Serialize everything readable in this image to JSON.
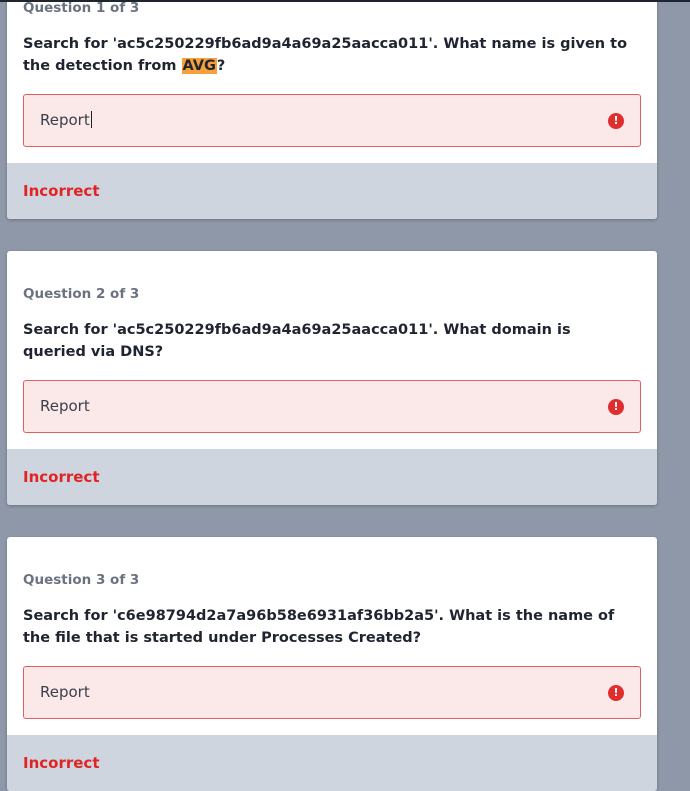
{
  "questions": [
    {
      "header": "Question 1 of 3",
      "text_before": "Search for 'ac5c250229fb6ad9a4a69a25aacca011'. What name is given to the detection from ",
      "text_highlight": "AVG",
      "text_after": "?",
      "answer": "Report",
      "result": "Incorrect",
      "focused": true
    },
    {
      "header": "Question 2 of 3",
      "text": "Search for 'ac5c250229fb6ad9a4a69a25aacca011'. What domain is queried via DNS?",
      "answer": "Report",
      "result": "Incorrect"
    },
    {
      "header": "Question 3 of 3",
      "text": "Search for 'c6e98794d2a7a96b58e6931af36bb2a5'. What is the name of the file that is started under Processes Created?",
      "answer": "Report",
      "result": "Incorrect"
    }
  ],
  "icons": {
    "error": "error-circle-icon"
  },
  "colors": {
    "error_red": "#e02424",
    "highlight": "#f6a03b",
    "page_bg": "#8f98a8",
    "result_bar_bg": "#cfd5de"
  }
}
